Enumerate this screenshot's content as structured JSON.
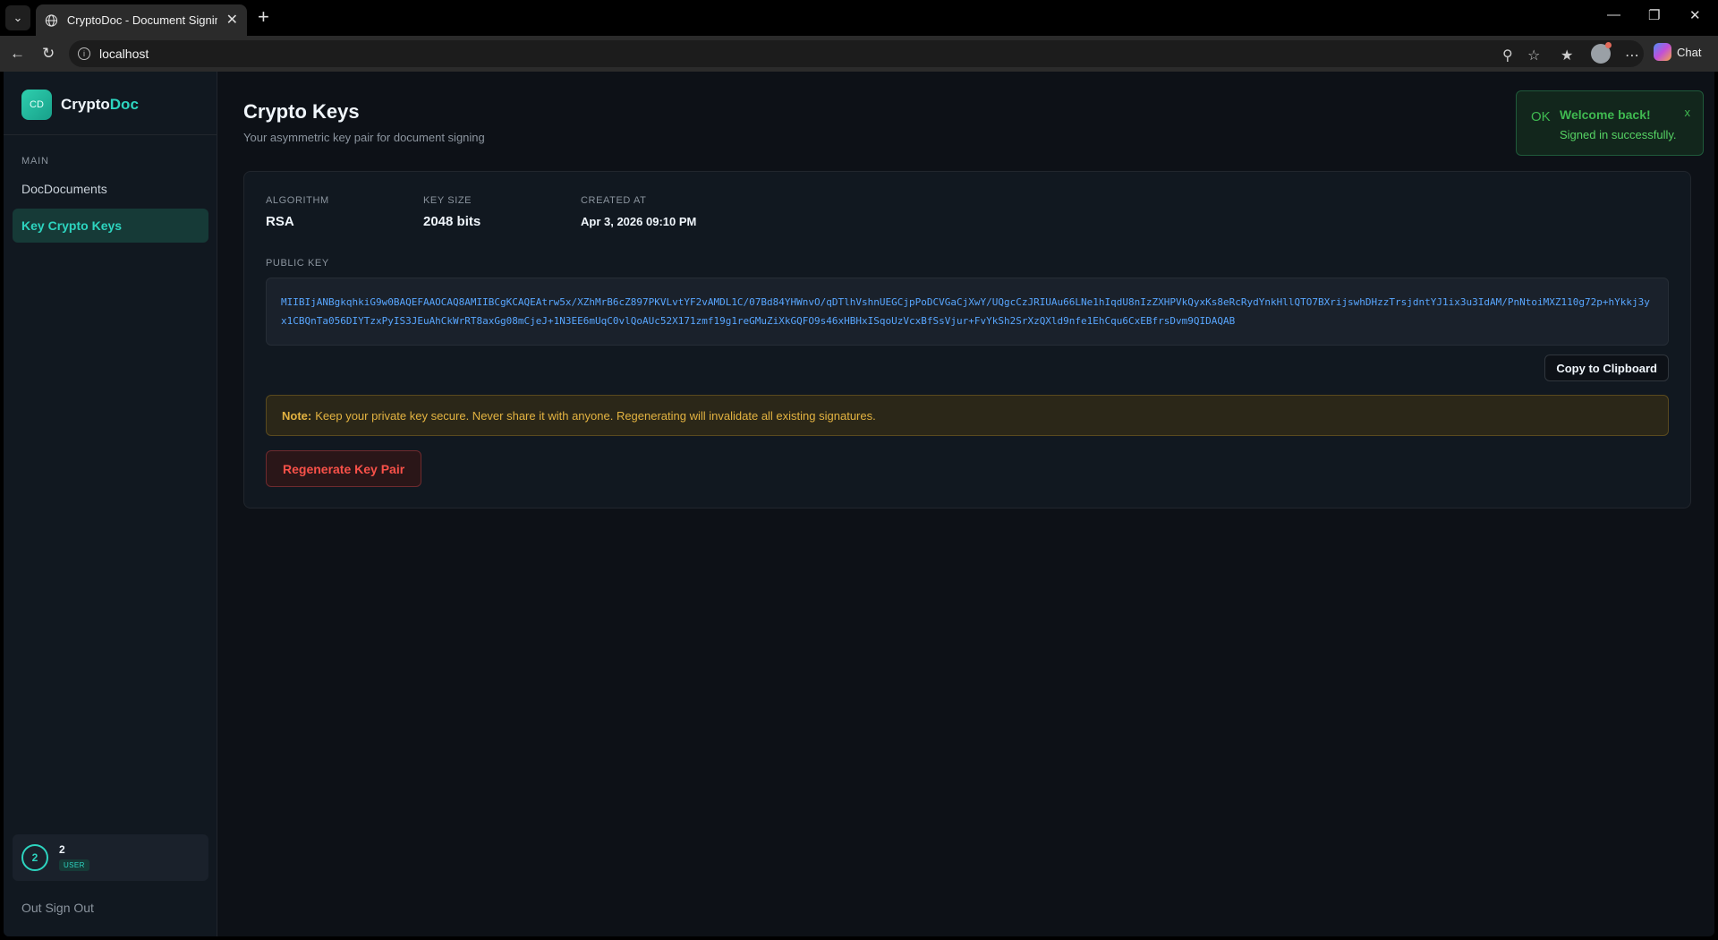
{
  "browser": {
    "tab_title": "CryptoDoc - Document Signing Pl",
    "url": "localhost",
    "chat_label": "Chat"
  },
  "sidebar": {
    "brand_initials": "CD",
    "brand_name_1": "Crypto",
    "brand_name_2": "Doc",
    "section_label": "MAIN",
    "items": [
      {
        "prefix": "Doc",
        "label": "Documents",
        "active": false
      },
      {
        "prefix": "Key",
        "label": "Crypto Keys",
        "active": true
      }
    ],
    "user": {
      "avatar": "2",
      "name": "2",
      "role": "USER"
    },
    "signout_prefix": "Out",
    "signout_label": "Sign Out"
  },
  "main": {
    "title": "Crypto Keys",
    "subtitle": "Your asymmetric key pair for document signing",
    "meta": {
      "algorithm_label": "ALGORITHM",
      "algorithm_value": "RSA",
      "keysize_label": "KEY SIZE",
      "keysize_value": "2048 bits",
      "created_label": "CREATED AT",
      "created_value": "Apr 3, 2026 09:10 PM"
    },
    "public_key_label": "PUBLIC KEY",
    "public_key": "MIIBIjANBgkqhkiG9w0BAQEFAAOCAQ8AMIIBCgKCAQEAtrw5x/XZhMrB6cZ897PKVLvtYF2vAMDL1C/07Bd84YHWnvO/qDTlhVshnUEGCjpPoDCVGaCjXwY/UQgcCzJRIUAu66LNe1hIqdU8nIzZXHPVkQyxKs8eRcRydYnkHllQTO7BXrijswhDHzzTrsjdntYJ1ix3u3IdAM/PnNtoiMXZ110g72p+hYkkj3yx1CBQnTa056DIYTzxPyIS3JEuAhCkWrRT8axGg08mCjeJ+1N3EE6mUqC0vlQoAUc52X171zmf19g1reGMuZiXkGQFO9s46xHBHxISqoUzVcxBfSsVjur+FvYkSh2SrXzQXld9nfe1EhCqu6CxEBfrsDvm9QIDAQAB",
    "copy_button": "Copy to Clipboard",
    "note_label": "Note:",
    "note_text": "Keep your private key secure. Never share it with anyone. Regenerating will invalidate all existing signatures.",
    "regenerate_button": "Regenerate Key Pair"
  },
  "toast": {
    "ok": "OK",
    "title": "Welcome back!",
    "message": "Signed in successfully.",
    "close": "x"
  },
  "colors": {
    "accent": "#2dd4bf",
    "danger": "#f85149",
    "success": "#3fb950",
    "warning": "#e3b341",
    "key_text": "#58a6ff"
  }
}
